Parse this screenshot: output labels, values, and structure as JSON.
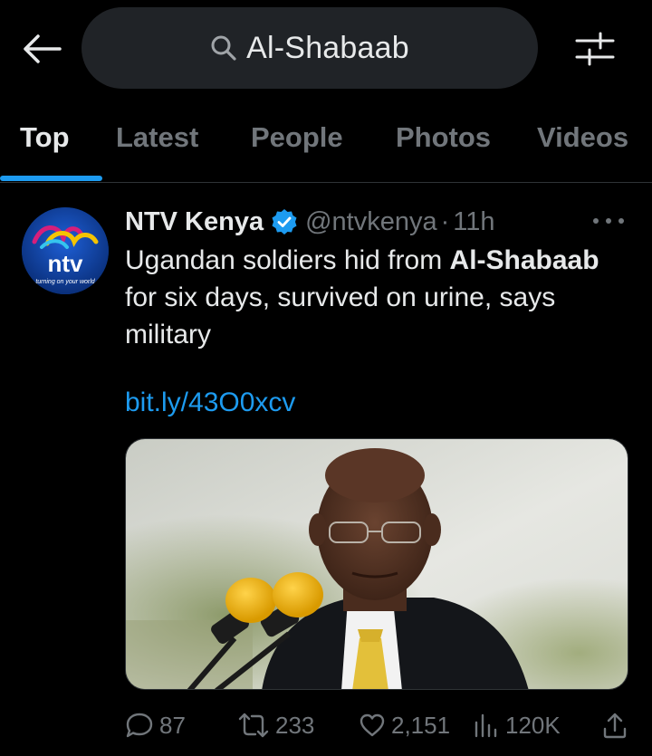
{
  "header": {
    "search_query": "Al-Shabaab",
    "back_icon": "arrow-left-icon",
    "search_icon": "search-icon",
    "filter_icon": "sliders-icon"
  },
  "tabs": [
    {
      "label": "Top",
      "active": true
    },
    {
      "label": "Latest",
      "active": false
    },
    {
      "label": "People",
      "active": false
    },
    {
      "label": "Photos",
      "active": false
    },
    {
      "label": "Videos",
      "active": false
    }
  ],
  "tweet": {
    "display_name": "NTV Kenya",
    "handle": "@ntvkenya",
    "separator": "·",
    "time": "11h",
    "avatar_text": "ntv",
    "avatar_tagline": "turning on your world",
    "text_before": "Ugandan soldiers hid from ",
    "text_bold": "Al-Shabaab",
    "text_after": " for six days, survived on urine, says military",
    "link": "bit.ly/43O0xcv",
    "replies": "87",
    "retweets": "233",
    "likes": "2,151",
    "views": "120K"
  },
  "colors": {
    "background": "#000000",
    "accent": "#1d9bf0",
    "secondary_text": "#71767b",
    "primary_text": "#e7e9ea",
    "search_bg": "#202327"
  }
}
